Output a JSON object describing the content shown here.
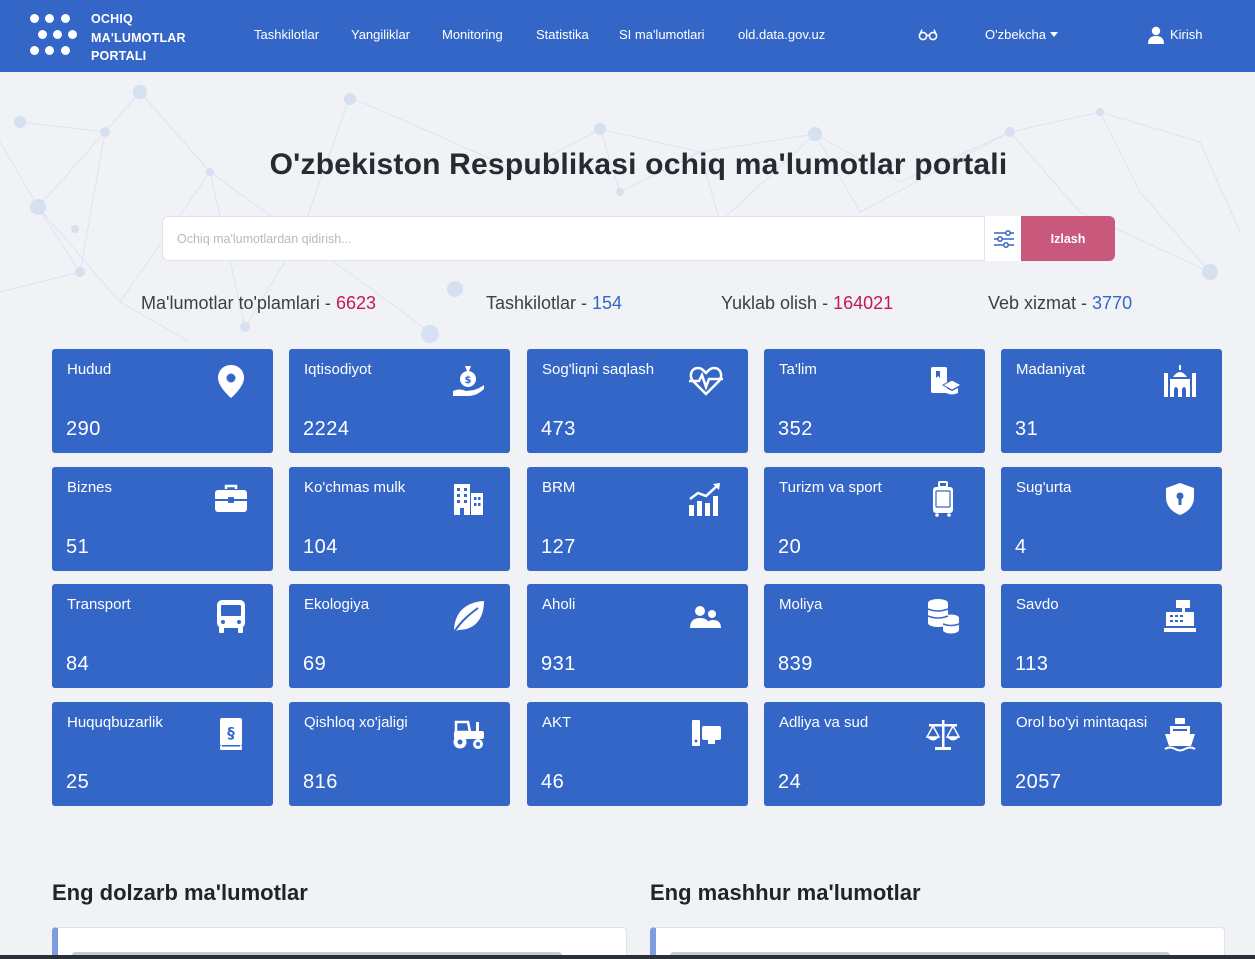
{
  "header": {
    "logo_lines": [
      "OCHIQ",
      "MA'LUMOTLAR",
      "PORTALI"
    ],
    "nav": [
      "Tashkilotlar",
      "Yangiliklar",
      "Monitoring",
      "Statistika",
      "SI ma'lumotlari",
      "old.data.gov.uz"
    ],
    "language": "O'zbekcha",
    "login": "Kirish"
  },
  "hero": {
    "title": "O'zbekiston Respublikasi ochiq ma'lumotlar portali",
    "search_placeholder": "Ochiq ma'lumotlardan qidirish...",
    "search_button": "Izlash"
  },
  "stats": [
    {
      "label": "Ma'lumotlar to'plamlari - ",
      "value": "6623",
      "color": "#c2185b"
    },
    {
      "label": "Tashkilotlar - ",
      "value": "154",
      "color": "#3466c8"
    },
    {
      "label": "Yuklab olish - ",
      "value": "164021",
      "color": "#c2185b"
    },
    {
      "label": "Veb xizmat - ",
      "value": "3770",
      "color": "#3466c8"
    }
  ],
  "categories": [
    {
      "title": "Hudud",
      "count": "290",
      "icon": "location-pin-icon"
    },
    {
      "title": "Iqtisodiyot",
      "count": "2224",
      "icon": "money-bag-hand-icon"
    },
    {
      "title": "Sog'liqni saqlash",
      "count": "473",
      "icon": "heart-pulse-icon"
    },
    {
      "title": "Ta'lim",
      "count": "352",
      "icon": "education-book-icon"
    },
    {
      "title": "Madaniyat",
      "count": "31",
      "icon": "mosque-icon"
    },
    {
      "title": "Biznes",
      "count": "51",
      "icon": "briefcase-icon"
    },
    {
      "title": "Ko'chmas mulk",
      "count": "104",
      "icon": "building-icon"
    },
    {
      "title": "BRM",
      "count": "127",
      "icon": "growth-chart-icon"
    },
    {
      "title": "Turizm va sport",
      "count": "20",
      "icon": "suitcase-icon"
    },
    {
      "title": "Sug'urta",
      "count": "4",
      "icon": "shield-lock-icon"
    },
    {
      "title": "Transport",
      "count": "84",
      "icon": "bus-icon"
    },
    {
      "title": "Ekologiya",
      "count": "69",
      "icon": "leaf-icon"
    },
    {
      "title": "Aholi",
      "count": "931",
      "icon": "people-icon"
    },
    {
      "title": "Moliya",
      "count": "839",
      "icon": "coins-icon"
    },
    {
      "title": "Savdo",
      "count": "113",
      "icon": "cash-register-icon"
    },
    {
      "title": "Huquqbuzarlik",
      "count": "25",
      "icon": "law-book-icon"
    },
    {
      "title": "Qishloq xo'jaligi",
      "count": "816",
      "icon": "tractor-icon"
    },
    {
      "title": "AKT",
      "count": "46",
      "icon": "devices-icon"
    },
    {
      "title": "Adliya va sud",
      "count": "24",
      "icon": "scales-icon"
    },
    {
      "title": "Orol bo'yi mintaqasi",
      "count": "2057",
      "icon": "ship-icon"
    }
  ],
  "sections": {
    "latest": "Eng dolzarb ma'lumotlar",
    "popular": "Eng mashhur ma'lumotlar"
  },
  "colors": {
    "primary": "#3466c8",
    "accent": "#c8587c",
    "background": "#f0f2f6"
  }
}
